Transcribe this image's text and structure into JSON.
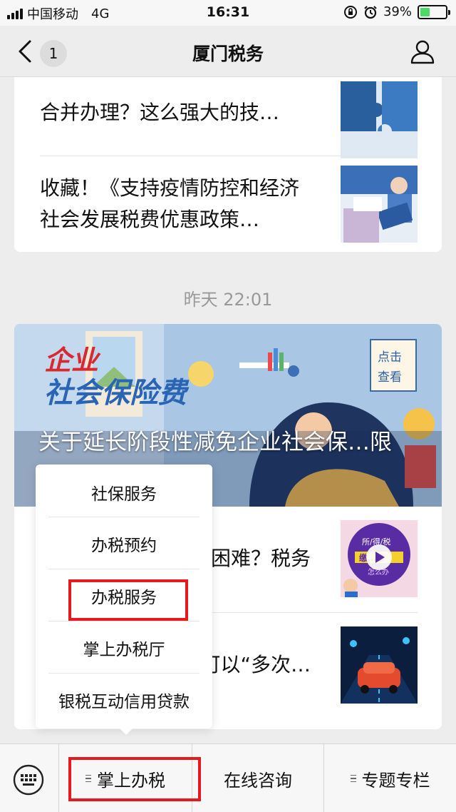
{
  "status_bar": {
    "carrier": "中国移动",
    "network": "4G",
    "time": "16:31",
    "battery": "39%",
    "battery_level": 0.39,
    "battery_color": "#4cd964"
  },
  "nav": {
    "title": "厦门税务",
    "unread_badge": "1",
    "back_icon": "chevron-left-icon",
    "profile_icon": "user-icon"
  },
  "articles_top": [
    {
      "title": "合并办理？这么强大的技…"
    },
    {
      "title": "收藏！《支持疫情防控和经济社会发展税费优惠政策…"
    }
  ],
  "timestamp": "昨天 22:01",
  "featured": {
    "cover_heading_1": "企业",
    "cover_heading_2": "社会保险费",
    "cover_badge": "点击查看",
    "title": "关于延长阶段性减免企业社会保…限有关事项的…"
  },
  "articles_bottom": [
    {
      "title": "…困难？税务",
      "thumb_text_1": "所/得/税",
      "thumb_text_2": "缴…难",
      "thumb_text_3": "怎么办"
    },
    {
      "title": "…收费公路…可以“多次…"
    }
  ],
  "popup_menu": {
    "items": [
      "社保服务",
      "办税预约",
      "办税服务",
      "掌上办税厅",
      "银税互动信用贷款"
    ]
  },
  "bottom_menu": {
    "keyboard_icon": "keyboard-icon",
    "items": [
      "掌上办税",
      "在线咨询",
      "专题专栏"
    ]
  },
  "accent_color": "#e8191e"
}
